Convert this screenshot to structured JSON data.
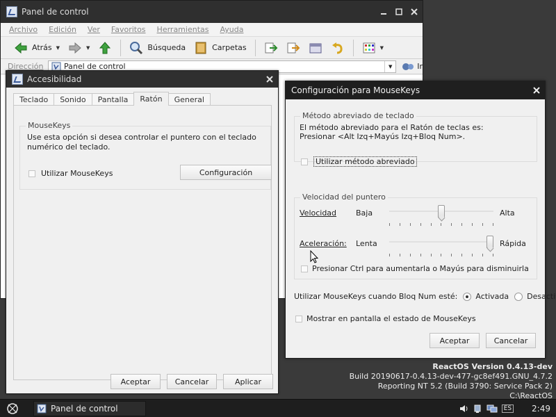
{
  "control_panel": {
    "title": "Panel de control",
    "menu": [
      "Archivo",
      "Edición",
      "Ver",
      "Favoritos",
      "Herramientas",
      "Ayuda"
    ],
    "toolbar": {
      "back": "Atrás",
      "search": "Búsqueda",
      "folders": "Carpetas"
    },
    "address_label": "Dirección",
    "address_value": "Panel de control",
    "go": "Ir"
  },
  "accessibility": {
    "title": "Accesibilidad",
    "tabs": [
      "Teclado",
      "Sonido",
      "Pantalla",
      "Ratón",
      "General"
    ],
    "active_tab": "Ratón",
    "group_label": "MouseKeys",
    "description": "Use esta opción si desea controlar el puntero con el teclado numérico del teclado.",
    "use_mousekeys": "Utilizar MouseKeys",
    "settings_button": "Configuración",
    "buttons": {
      "ok": "Aceptar",
      "cancel": "Cancelar",
      "apply": "Aplicar"
    }
  },
  "mousekeys_config": {
    "title": "Configuración para MouseKeys",
    "shortcut_group": "Método abreviado de teclado",
    "shortcut_text_1": "El método abreviado para el Ratón de teclas es:",
    "shortcut_text_2": "Presionar <Alt Izq+Mayús Izq+Bloq Num>.",
    "use_shortcut": "Utilizar método abreviado",
    "speed_group": "Velocidad del puntero",
    "speed_label": "Velocidad",
    "speed_low": "Baja",
    "speed_high": "Alta",
    "speed_value": 0.5,
    "accel_label": "Aceleración:",
    "accel_low": "Lenta",
    "accel_high": "Rápida",
    "accel_value": 1.0,
    "ctrl_shift": "Presionar Ctrl para aumentarla o Mayús para disminuirla",
    "numlock_label": "Utilizar MouseKeys cuando Bloq Num esté:",
    "numlock_on": "Activada",
    "numlock_off": "Desactivada",
    "show_status": "Mostrar en pantalla el estado de MouseKeys",
    "ok": "Aceptar",
    "cancel": "Cancelar"
  },
  "os_info": {
    "version": "ReactOS Version 0.4.13-dev",
    "build": "Build 20190617-0.4.13-dev-477-gc8ef491.GNU_4.7.2",
    "reporting": "Reporting NT 5.2 (Build 3790: Service Pack 2)",
    "path": "C:\\ReactOS"
  },
  "taskbar": {
    "task_label": "Panel de control",
    "lang": "ES",
    "clock": "2:49"
  }
}
